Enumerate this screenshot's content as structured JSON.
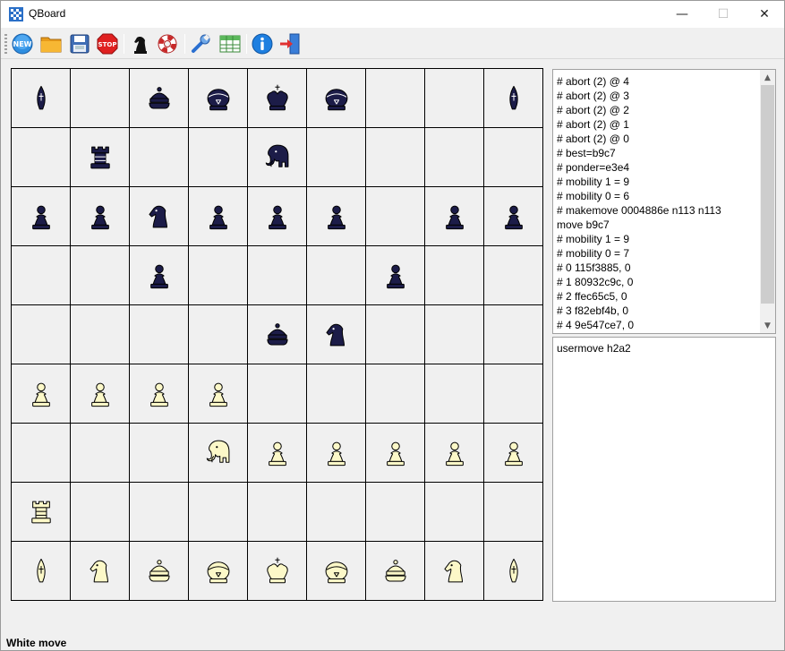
{
  "window": {
    "title": "QBoard",
    "icon": "board-icon",
    "controls": {
      "minimize": "—",
      "maximize": "☐",
      "close": "✕"
    }
  },
  "toolbar": {
    "buttons": [
      {
        "name": "new-game",
        "icon": "new-icon"
      },
      {
        "name": "open",
        "icon": "folder-icon"
      },
      {
        "name": "save",
        "icon": "floppy-icon"
      },
      {
        "name": "stop",
        "icon": "stop-icon"
      },
      {
        "name": "engine",
        "icon": "knight-icon"
      },
      {
        "name": "flip-board",
        "icon": "lifebuoy-icon"
      },
      {
        "name": "settings",
        "icon": "wrench-icon"
      },
      {
        "name": "table",
        "icon": "table-icon"
      },
      {
        "name": "about",
        "icon": "info-icon"
      },
      {
        "name": "exit",
        "icon": "exit-icon"
      }
    ],
    "new_label": "NEW",
    "stop_label": "STOP"
  },
  "board": {
    "files": 9,
    "ranks": 9,
    "colors": {
      "black_piece": "#1c1c48",
      "white_piece": "#fcf8c8",
      "outline": "#000000",
      "square": "#f0f0f0"
    },
    "rows": [
      [
        "b-lance",
        "",
        "b-prince",
        "b-general",
        "b-king",
        "b-general",
        "",
        "",
        "b-lance"
      ],
      [
        "",
        "b-rook",
        "",
        "",
        "b-elephant",
        "",
        "",
        "",
        ""
      ],
      [
        "b-pawn",
        "b-pawn",
        "b-knight",
        "b-pawn",
        "b-pawn",
        "b-pawn",
        "",
        "b-pawn",
        "b-pawn"
      ],
      [
        "",
        "",
        "b-pawn",
        "",
        "",
        "",
        "b-pawn",
        "",
        ""
      ],
      [
        "",
        "",
        "",
        "",
        "b-prince",
        "b-knight",
        "",
        "",
        ""
      ],
      [
        "w-pawn",
        "w-pawn",
        "w-pawn",
        "w-pawn",
        "",
        "",
        "",
        "",
        ""
      ],
      [
        "",
        "",
        "",
        "w-elephant",
        "w-pawn",
        "w-pawn",
        "w-pawn",
        "w-pawn",
        "w-pawn"
      ],
      [
        "w-rook",
        "",
        "",
        "",
        "",
        "",
        "",
        "",
        ""
      ],
      [
        "w-lance",
        "w-knight",
        "w-prince",
        "w-general",
        "w-king",
        "w-general",
        "w-prince",
        "w-knight",
        "w-lance"
      ]
    ]
  },
  "engine_log": {
    "lines": [
      "# abort (2) @ 4",
      "# abort (2) @ 3",
      "# abort (2) @ 2",
      "# abort (2) @ 1",
      "# abort (2) @ 0",
      "# best=b9c7",
      "# ponder=e3e4",
      "# mobility 1 = 9",
      "# mobility 0 = 6",
      "# makemove 0004886e n113 n113",
      "move b9c7",
      "# mobility 1 = 9",
      "# mobility 0 = 7",
      "# 0 115f3885, 0",
      "# 1 80932c9c, 0",
      "# 2 ffec65c5, 0",
      "# 3 f82ebf4b, 0",
      "# 4 9e547ce7, 0"
    ],
    "scroll_up": "▲",
    "scroll_down": "▼"
  },
  "command_input": {
    "value": "usermove h2a2"
  },
  "status": {
    "text": "White move"
  }
}
